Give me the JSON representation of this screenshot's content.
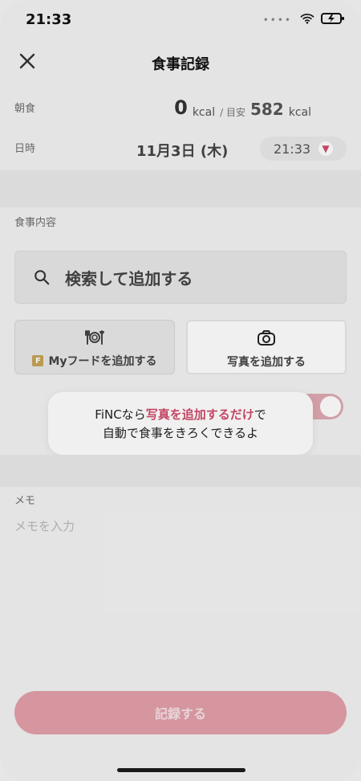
{
  "status_bar": {
    "time": "21:33",
    "signal_dots": "••••"
  },
  "header": {
    "title": "食事記録"
  },
  "meal": {
    "meal_type": "朝食",
    "kcal_value": "0",
    "kcal_unit": "kcal",
    "goal_prefix": "/ 目安",
    "goal_value": "582",
    "goal_unit": "kcal"
  },
  "datetime": {
    "label": "日時",
    "date": "11月3日 (木)",
    "time": "21:33"
  },
  "content": {
    "section_title": "食事内容",
    "search_label": "検索して追加する",
    "my_food_badge": "F",
    "my_food_label": "Myフードを追加する",
    "photo_label": "写真を追加する"
  },
  "tooltip": {
    "line1_prefix": "FiNCなら",
    "line1_highlight": "写真を追加するだけ",
    "line1_suffix": "で",
    "line2": "自動で食事をきろくできるよ"
  },
  "memo": {
    "title": "メモ",
    "placeholder": "メモを入力"
  },
  "footer": {
    "record_button": "記録する"
  }
}
